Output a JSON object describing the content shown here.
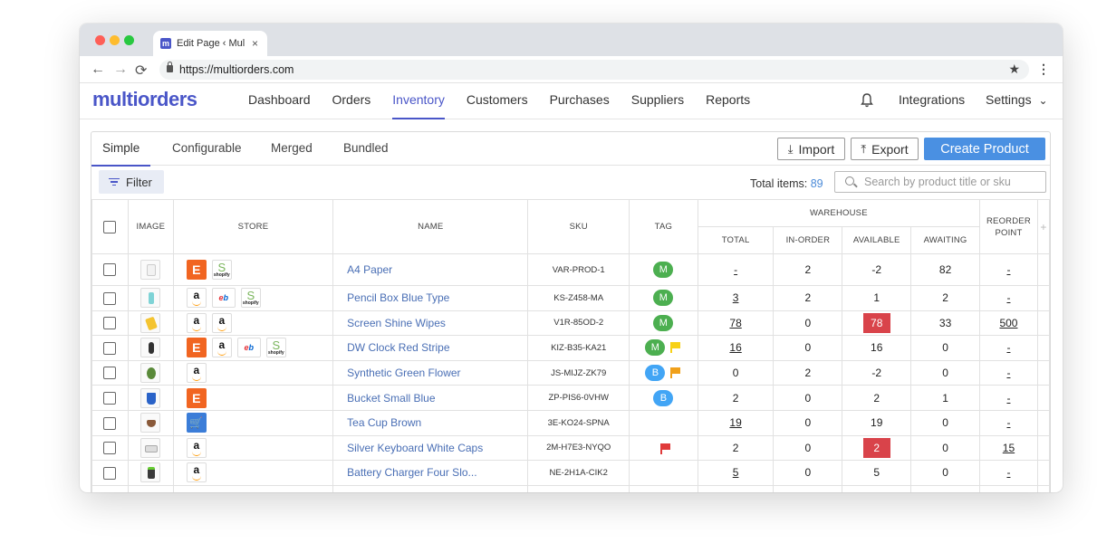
{
  "browser": {
    "tab_title": "Edit Page ‹ Mul",
    "favicon_letter": "m",
    "close_glyph": "×",
    "url": "https://multiorders.com",
    "back_glyph": "←",
    "forward_glyph": "→",
    "reload_glyph": "⟳",
    "star_glyph": "★",
    "menu_glyph": "⋮"
  },
  "app": {
    "logo": "multiorders",
    "nav": [
      "Dashboard",
      "Orders",
      "Inventory",
      "Customers",
      "Purchases",
      "Suppliers",
      "Reports"
    ],
    "active_nav": "Inventory",
    "integrations": "Integrations",
    "settings": "Settings",
    "settings_chevron": "⌄"
  },
  "subtabs": [
    "Simple",
    "Configurable",
    "Merged",
    "Bundled"
  ],
  "actions": {
    "import": "Import",
    "import_glyph": "⤓",
    "export": "Export",
    "export_glyph": "⤒",
    "create": "Create Product"
  },
  "toolbar": {
    "filter": "Filter",
    "total_label": "Total items:",
    "total_value": "89",
    "search_placeholder": "Search by product title or sku"
  },
  "table": {
    "headers": {
      "image": "IMAGE",
      "store": "STORE",
      "name": "NAME",
      "sku": "SKU",
      "tag": "TAG",
      "warehouse": "WAREHOUSE",
      "total": "TOTAL",
      "in_order": "IN-ORDER",
      "available": "AVAILABLE",
      "awaiting": "AWAITING",
      "reorder_point": "REORDER POINT",
      "add_col": "+"
    },
    "rows": [
      {
        "name": "A4 Paper",
        "sku": "VAR-PROD-1",
        "total": "-",
        "in_order": "2",
        "available": "-2",
        "awaiting": "82",
        "reorder": "-"
      },
      {
        "name": "Pencil Box Blue Type",
        "sku": "KS-Z458-MA",
        "total": "3",
        "in_order": "2",
        "available": "1",
        "awaiting": "2",
        "reorder": "-"
      },
      {
        "name": "Screen Shine Wipes",
        "sku": "V1R-85OD-2",
        "total": "78",
        "in_order": "0",
        "available": "78",
        "awaiting": "33",
        "reorder": "500"
      },
      {
        "name": "DW Clock Red Stripe",
        "sku": "KIZ-B35-KA21",
        "total": "16",
        "in_order": "0",
        "available": "16",
        "awaiting": "0",
        "reorder": "-"
      },
      {
        "name": "Synthetic Green Flower",
        "sku": "JS-MIJZ-ZK79",
        "total": "0",
        "in_order": "2",
        "available": "-2",
        "awaiting": "0",
        "reorder": "-"
      },
      {
        "name": "Bucket Small Blue",
        "sku": "ZP-PIS6-0VHW",
        "total": "2",
        "in_order": "0",
        "available": "2",
        "awaiting": "1",
        "reorder": "-"
      },
      {
        "name": "Tea Cup Brown",
        "sku": "3E-KO24-SPNA",
        "total": "19",
        "in_order": "0",
        "available": "19",
        "awaiting": "0",
        "reorder": "-"
      },
      {
        "name": "Silver Keyboard White Caps",
        "sku": "2M-H7E3-NYQO",
        "total": "2",
        "in_order": "0",
        "available": "2",
        "awaiting": "0",
        "reorder": "15"
      },
      {
        "name": "Battery Charger Four Slo...",
        "sku": "NE-2H1A-CIK2",
        "total": "5",
        "in_order": "0",
        "available": "5",
        "awaiting": "0",
        "reorder": "-"
      }
    ]
  },
  "store_labels": {
    "etsy": "E",
    "amazon": "a",
    "ebay_e": "e",
    "ebay_b": "b",
    "ebay_a": "a",
    "ebay_y": "y",
    "shopify": "S",
    "cart": "🛒"
  },
  "tag_labels": {
    "M": "M",
    "B": "B"
  },
  "colors": {
    "brand": "#4a56c8",
    "primary_button": "#4a90e2",
    "tag_m": "#4caf50",
    "tag_b": "#42a5f5",
    "alert_red": "#d9434a"
  }
}
